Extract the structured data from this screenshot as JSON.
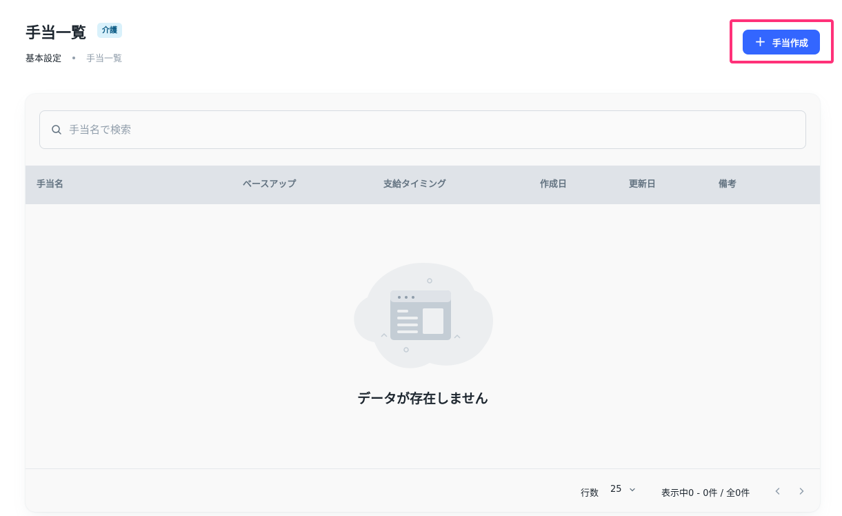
{
  "header": {
    "title": "手当一覧",
    "badge": "介護",
    "breadcrumb": [
      "基本設定",
      "手当一覧"
    ]
  },
  "actions": {
    "create_label": "手当作成",
    "create_icon": "plus-icon",
    "highlight_color": "#ff3179",
    "button_color": "#3366ff"
  },
  "search": {
    "placeholder": "手当名で検索",
    "value": ""
  },
  "table": {
    "columns": [
      "手当名",
      "ベースアップ",
      "支給タイミング",
      "作成日",
      "更新日",
      "備考"
    ],
    "rows": [],
    "empty_message": "データが存在しません"
  },
  "pagination": {
    "rows_label": "行数",
    "rows_per_page": "25",
    "range_text": "表示中0 - 0件 / 全0件"
  }
}
